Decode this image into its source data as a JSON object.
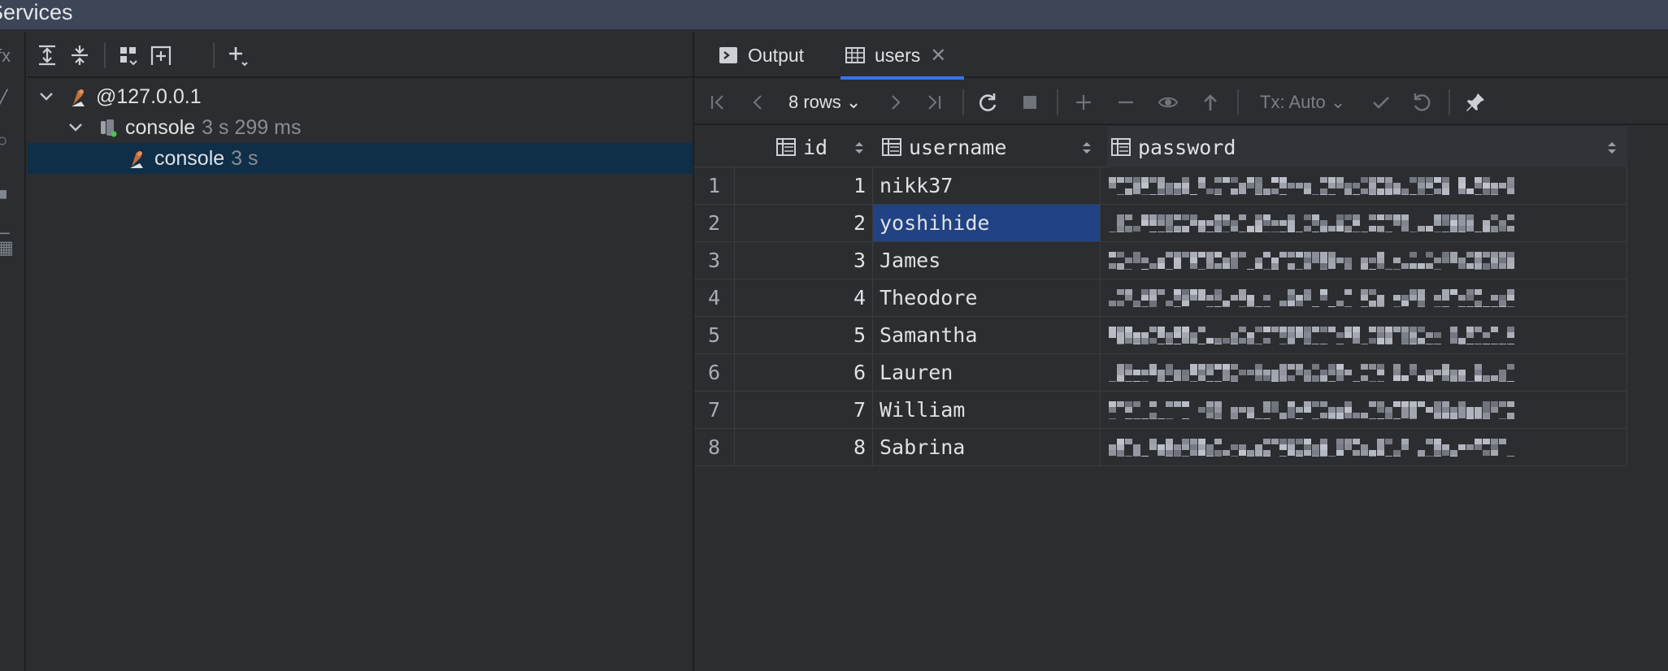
{
  "window": {
    "title": "Services"
  },
  "left_toolbar": {
    "icons": [
      "expand-all-icon",
      "collapse-all-icon",
      "group-by-icon",
      "new-service-icon",
      "add-icon"
    ]
  },
  "tree": [
    {
      "label": "@127.0.0.1",
      "meta": "",
      "level": 0,
      "expanded": true,
      "icon": "database-connection-icon"
    },
    {
      "label": "console",
      "meta": "3 s 299 ms",
      "level": 1,
      "expanded": true,
      "icon": "console-session-icon"
    },
    {
      "label": "console",
      "meta": "3 s",
      "level": 2,
      "expanded": false,
      "icon": "console-icon",
      "selected": true
    }
  ],
  "tabs": [
    {
      "label": "Output",
      "icon": "output-icon",
      "active": false
    },
    {
      "label": "users",
      "icon": "table-icon",
      "active": true
    }
  ],
  "grid_toolbar": {
    "rows_label": "8 rows",
    "tx_label": "Tx: Auto"
  },
  "table": {
    "columns": [
      "id",
      "username",
      "password"
    ],
    "rows": [
      {
        "num": "1",
        "id": "1",
        "username": "nikk37"
      },
      {
        "num": "2",
        "id": "2",
        "username": "yoshihide"
      },
      {
        "num": "3",
        "id": "3",
        "username": "James"
      },
      {
        "num": "4",
        "id": "4",
        "username": "Theodore"
      },
      {
        "num": "5",
        "id": "5",
        "username": "Samantha"
      },
      {
        "num": "6",
        "id": "6",
        "username": "Lauren"
      },
      {
        "num": "7",
        "id": "7",
        "username": "William"
      },
      {
        "num": "8",
        "id": "8",
        "username": "Sabrina"
      }
    ]
  },
  "colors": {
    "accent": "#3574f0",
    "selection": "#214283",
    "tree_selection": "#0f2e48",
    "background": "#2b2d30"
  }
}
